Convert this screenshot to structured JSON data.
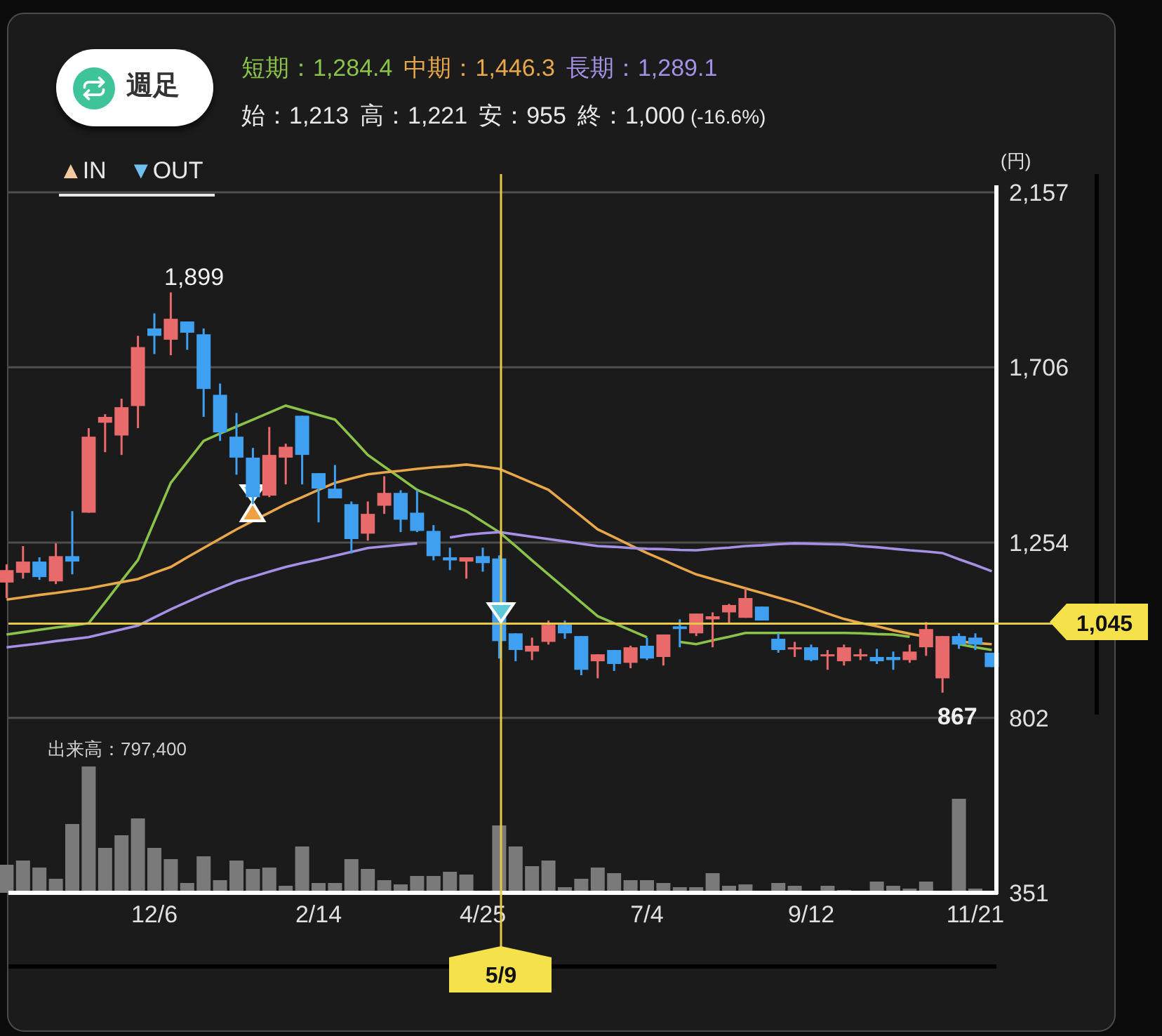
{
  "timeframe_button": {
    "label": "週足"
  },
  "indicators": [
    {
      "text": "短期：1,284.4",
      "color": "#8bc34a"
    },
    {
      "text": "中期：1,446.3",
      "color": "#e8a84a"
    },
    {
      "text": "長期：1,289.1",
      "color": "#a590e6"
    }
  ],
  "ohlc": [
    "始：1,213",
    "高：1,221",
    "安：955",
    "終：1,000"
  ],
  "change": "(-16.6%)",
  "legend": [
    {
      "symbol": "▲",
      "label": "IN",
      "color": "#f5c9a0"
    },
    {
      "symbol": "▼",
      "label": "OUT",
      "color": "#6fc0f0"
    }
  ],
  "chart": {
    "unit": "(円)",
    "high_label": "1,899",
    "low_label": "867",
    "current_price": "1,045",
    "cursor_date": "5/9",
    "volume_label": "出来高：797,400",
    "chart_data": {
      "type": "candlestick",
      "categories": [
        null,
        null,
        null,
        null,
        null,
        null,
        null,
        null,
        null,
        "12/6",
        null,
        null,
        null,
        null,
        null,
        null,
        null,
        null,
        null,
        "2/14",
        null,
        null,
        null,
        null,
        null,
        null,
        null,
        null,
        null,
        "4/25",
        null,
        null,
        null,
        null,
        null,
        null,
        null,
        null,
        null,
        "7/4",
        null,
        null,
        null,
        null,
        null,
        null,
        null,
        null,
        null,
        "9/12",
        null,
        null,
        null,
        null,
        null,
        null,
        null,
        null,
        null,
        "11/21",
        null
      ],
      "ohlc": [
        [
          1151,
          1198,
          1111,
          1183
        ],
        [
          1176,
          1245,
          1161,
          1205
        ],
        [
          1205,
          1216,
          1158,
          1165
        ],
        [
          1154,
          1252,
          1147,
          1219
        ],
        [
          1219,
          1335,
          1172,
          1205
        ],
        [
          1331,
          1549,
          1331,
          1527
        ],
        [
          1563,
          1585,
          1487,
          1578
        ],
        [
          1530,
          1625,
          1480,
          1603
        ],
        [
          1606,
          1787,
          1549,
          1758
        ],
        [
          1806,
          1845,
          1740,
          1787
        ],
        [
          1777,
          1899,
          1737,
          1831
        ],
        [
          1824,
          1824,
          1751,
          1795
        ],
        [
          1791,
          1806,
          1578,
          1650
        ],
        [
          1635,
          1664,
          1516,
          1538
        ],
        [
          1527,
          1588,
          1429,
          1473
        ],
        [
          1473,
          1498,
          1353,
          1371
        ],
        [
          1375,
          1552,
          1371,
          1480
        ],
        [
          1473,
          1509,
          1404,
          1501
        ],
        [
          1581,
          1581,
          1404,
          1480
        ],
        [
          1433,
          1433,
          1306,
          1393
        ],
        [
          1393,
          1454,
          1368,
          1368
        ],
        [
          1353,
          1360,
          1226,
          1263
        ],
        [
          1277,
          1360,
          1259,
          1328
        ],
        [
          1349,
          1425,
          1328,
          1382
        ],
        [
          1382,
          1389,
          1281,
          1313
        ],
        [
          1331,
          1389,
          1281,
          1284
        ],
        [
          1284,
          1299,
          1208,
          1219
        ],
        [
          1216,
          1241,
          1183,
          1208
        ],
        [
          1205,
          1216,
          1161,
          1216
        ],
        [
          1219,
          1241,
          1179,
          1201
        ],
        [
          1213,
          1221,
          955,
          1000
        ],
        [
          1020,
          1020,
          948,
          977
        ],
        [
          973,
          1009,
          951,
          988
        ],
        [
          998,
          1053,
          991,
          1042
        ],
        [
          1042,
          1053,
          1006,
          1020
        ],
        [
          1013,
          1013,
          912,
          926
        ],
        [
          948,
          966,
          904,
          966
        ],
        [
          977,
          977,
          923,
          941
        ],
        [
          944,
          988,
          930,
          984
        ],
        [
          988,
          1009,
          951,
          955
        ],
        [
          959,
          1017,
          937,
          1017
        ],
        [
          1038,
          1056,
          984,
          1031
        ],
        [
          1020,
          1071,
          1013,
          1071
        ],
        [
          1056,
          1074,
          984,
          1064
        ],
        [
          1074,
          1096,
          1045,
          1093
        ],
        [
          1060,
          1136,
          1060,
          1111
        ],
        [
          1089,
          1089,
          1053,
          1053
        ],
        [
          1006,
          1020,
          970,
          977
        ],
        [
          980,
          998,
          959,
          984
        ],
        [
          984,
          991,
          948,
          951
        ],
        [
          962,
          977,
          926,
          966
        ],
        [
          948,
          991,
          937,
          984
        ],
        [
          962,
          980,
          951,
          966
        ],
        [
          959,
          980,
          941,
          948
        ],
        [
          959,
          973,
          926,
          951
        ],
        [
          951,
          991,
          944,
          973
        ],
        [
          984,
          1049,
          962,
          1031
        ],
        [
          904,
          1013,
          867,
          1013
        ],
        [
          1013,
          1020,
          980,
          991
        ],
        [
          1009,
          1020,
          977,
          991
        ],
        [
          970,
          970,
          933,
          933
        ]
      ],
      "series": [
        {
          "type": "line",
          "color": "#8bc34a",
          "values": [
            1017,
            1023,
            1029,
            1035,
            1040,
            1046,
            1100,
            1155,
            1209,
            1309,
            1408,
            1462,
            1516,
            1535,
            1553,
            1571,
            1589,
            1607,
            1595,
            1583,
            1571,
            1526,
            1480,
            1450,
            1420,
            1390,
            1372,
            1353,
            1335,
            1308,
            1281,
            1245,
            1208,
            1172,
            1136,
            1100,
            1064,
            1046,
            1028,
            1010,
            null,
            998,
            992,
            1002,
            1011,
            1021,
            1021,
            1021,
            1021,
            1021,
            1021,
            1021,
            1020,
            1018,
            1017,
            1011,
            null,
            null,
            992,
            984,
            977
          ]
        },
        {
          "type": "line",
          "color": "#e8a84a",
          "values": [
            1107,
            1113,
            1119,
            1124,
            1130,
            1136,
            1144,
            1152,
            1160,
            1176,
            1191,
            1216,
            1240,
            1264,
            1288,
            1310,
            1331,
            1353,
            1371,
            1390,
            1408,
            1419,
            1430,
            1435,
            1439,
            1444,
            1448,
            1451,
            1455,
            1450,
            1444,
            1426,
            1408,
            1390,
            1356,
            1322,
            1288,
            1268,
            1247,
            1227,
            1209,
            1190,
            1172,
            1160,
            1148,
            1136,
            1124,
            1112,
            1100,
            1086,
            1071,
            1057,
            1047,
            1038,
            1028,
            1019,
            1011,
            null,
            999,
            995,
            992
          ]
        },
        {
          "type": "line",
          "color": "#a590e6",
          "values": [
            984,
            989,
            994,
            1000,
            1005,
            1010,
            1020,
            1030,
            1040,
            1061,
            1082,
            1101,
            1120,
            1137,
            1154,
            1166,
            1179,
            1191,
            1201,
            1210,
            1220,
            1230,
            1240,
            1244,
            1248,
            1252,
            null,
            1267,
            1274,
            1278,
            1281,
            1275,
            1269,
            1263,
            1257,
            1251,
            1245,
            1243,
            1240,
            1238,
            1237,
            1235,
            1234,
            1238,
            1241,
            1245,
            1247,
            1250,
            1252,
            1251,
            1250,
            1249,
            1245,
            1242,
            1238,
            1234,
            1231,
            1227,
            1211,
            1196,
            1180
          ]
        }
      ],
      "ylim": [
        351,
        2157
      ],
      "grid": true,
      "yticks": [
        {
          "value": 2157,
          "label": "2,157"
        },
        {
          "value": 1706,
          "label": "1,706"
        },
        {
          "value": 1254,
          "label": "1,254"
        },
        {
          "value": 802,
          "label": "802"
        },
        {
          "value": 351,
          "label": "351"
        }
      ]
    }
  }
}
